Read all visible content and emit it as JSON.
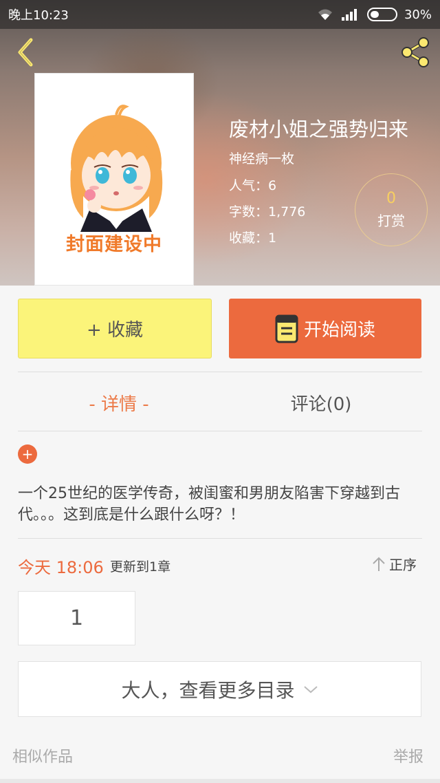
{
  "status_bar": {
    "time": "晚上10:23",
    "battery": "30%"
  },
  "colors": {
    "accent": "#ec6a3e",
    "collect_bg": "#fbf47a",
    "tip": "#f8d060"
  },
  "header": {
    "back_icon": "back-arrow-icon",
    "share_icon": "share-icon"
  },
  "cover": {
    "label": "封面建设中"
  },
  "book": {
    "title": "废材小姐之强势归来",
    "author": "神经病一枚",
    "popularity": "人气：6",
    "word_count": "字数：1,776",
    "favorites": "收藏：1"
  },
  "tip": {
    "count": "0",
    "label": "打赏"
  },
  "actions": {
    "collect": "+ 收藏",
    "read": "开始阅读"
  },
  "tabs": {
    "detail": "- 详情 -",
    "comments": "评论(0)"
  },
  "description": "一个25世纪的医学传奇，被闺蜜和男朋友陷害下穿越到古代。。。这到底是什么跟什么呀？！",
  "update": {
    "time": "今天 18:06",
    "text": "更新到1章",
    "sort_label": "正序"
  },
  "chapters": [
    "1"
  ],
  "more_catalog": "大人，查看更多目录",
  "footer": {
    "similar": "相似作品",
    "report": "举报"
  }
}
